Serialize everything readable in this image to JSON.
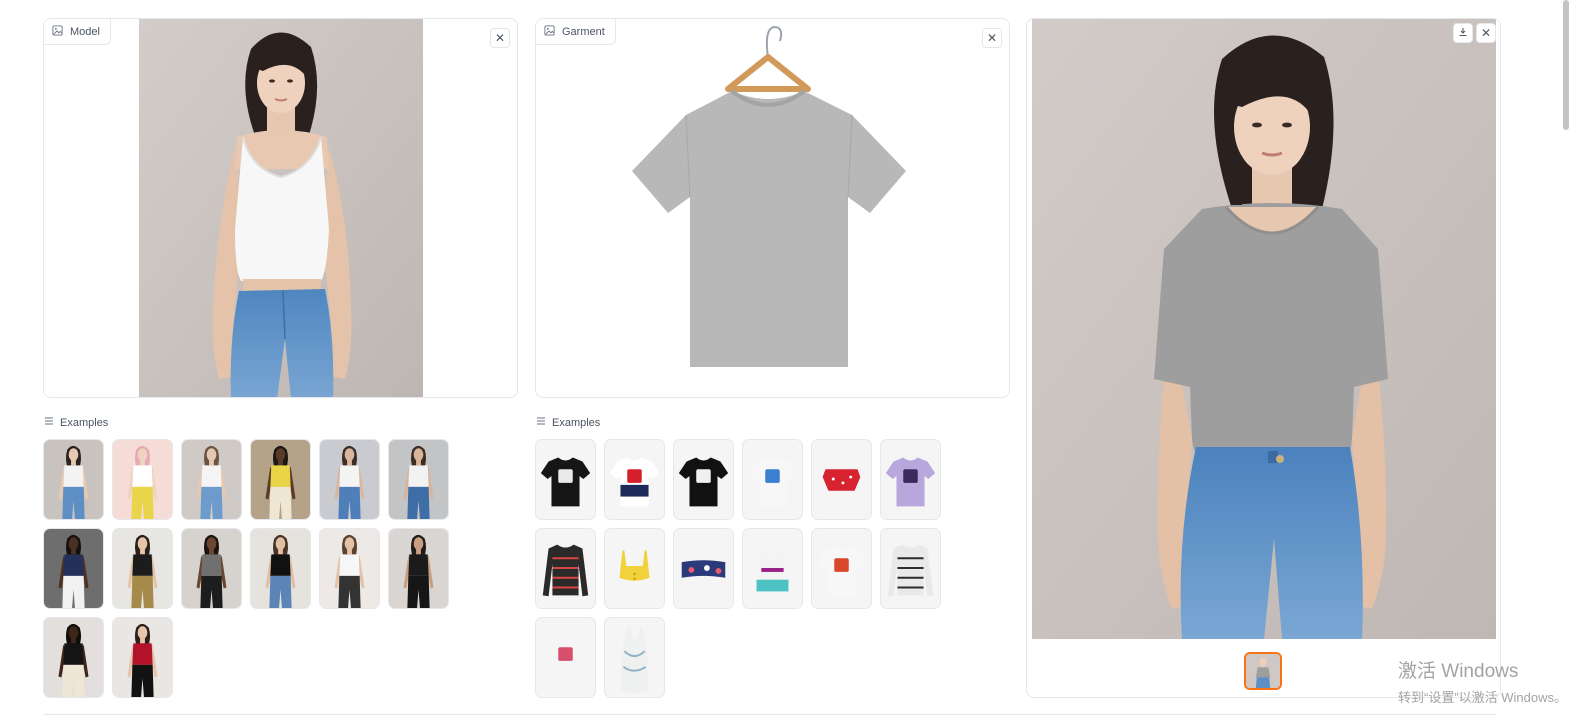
{
  "model_panel": {
    "label": "Model",
    "image_icon": "image-icon",
    "clear_icon": "close-icon"
  },
  "garment_panel": {
    "label": "Garment",
    "image_icon": "image-icon",
    "clear_icon": "close-icon"
  },
  "result_panel": {
    "download_icon": "download-icon",
    "clear_icon": "close-icon",
    "gallery_count": 1
  },
  "model_examples": {
    "label": "Examples",
    "icon": "list-icon",
    "items": [
      {
        "bg": "#c9c3bf",
        "skin": "#e7c8b0",
        "hair": "#2b2220",
        "top": "#f3f3f3",
        "bottom": "#5d8fc4"
      },
      {
        "bg": "#f6dcd6",
        "skin": "#f0d3bf",
        "hair": "#e6a9b6",
        "top": "#ffffff",
        "bottom": "#e9d54a"
      },
      {
        "bg": "#cfcac6",
        "skin": "#e6c7b0",
        "hair": "#6a5545",
        "top": "#f5f5f5",
        "bottom": "#6d9ccc"
      },
      {
        "bg": "#b5a389",
        "skin": "#5a3b27",
        "hair": "#1d1713",
        "top": "#e8d445",
        "bottom": "#efe6d3"
      },
      {
        "bg": "#c9cbd0",
        "skin": "#d9b79c",
        "hair": "#3a2e28",
        "top": "#f4f4f4",
        "bottom": "#4f7fb8"
      },
      {
        "bg": "#c3c4c6",
        "skin": "#d8b49a",
        "hair": "#3b2d23",
        "top": "#f2f2f2",
        "bottom": "#3f6ea6"
      },
      {
        "bg": "#6e6e6e",
        "skin": "#4a3122",
        "hair": "#16110e",
        "top": "#25305a",
        "bottom": "#f1f1f1"
      },
      {
        "bg": "#e8e6e3",
        "skin": "#e6c4a8",
        "hair": "#2a201b",
        "top": "#1c1c1c",
        "bottom": "#a68a4b"
      },
      {
        "bg": "#d6d3cf",
        "skin": "#6b4630",
        "hair": "#1a1411",
        "top": "#707070",
        "bottom": "#1d1d1d"
      },
      {
        "bg": "#e6e2de",
        "skin": "#e1bfa3",
        "hair": "#4a3427",
        "top": "#111111",
        "bottom": "#5b85b6"
      },
      {
        "bg": "#ece9e6",
        "skin": "#e3c2a8",
        "hair": "#5b4130",
        "top": "#f6f6f6",
        "bottom": "#333333"
      },
      {
        "bg": "#d9d5d2",
        "skin": "#c99f84",
        "hair": "#231b17",
        "top": "#1b1b1b",
        "bottom": "#161616"
      },
      {
        "bg": "#e3dfdc",
        "skin": "#3e2718",
        "hair": "#0f0c0a",
        "top": "#141414",
        "bottom": "#efe7d6"
      },
      {
        "bg": "#e9e6e3",
        "skin": "#e5c5ab",
        "hair": "#2b201b",
        "top": "#b3122b",
        "bottom": "#121212"
      }
    ]
  },
  "garment_examples": {
    "label": "Examples",
    "icon": "list-icon",
    "items": [
      {
        "shape": "tee",
        "color": "#161616",
        "accent": "#e9e9e9"
      },
      {
        "shape": "tee",
        "color": "#ffffff",
        "accent": "#d3202a",
        "band": "#1c2a5a"
      },
      {
        "shape": "tee",
        "color": "#111111",
        "accent": "#f0f0f0"
      },
      {
        "shape": "tee",
        "color": "#f7f7f7",
        "accent": "#3b7fd1"
      },
      {
        "shape": "crop",
        "color": "#d7232f",
        "accent": "#ffffff"
      },
      {
        "shape": "tee",
        "color": "#b8a7dc",
        "accent": "#3b2a5a"
      },
      {
        "shape": "long",
        "color": "#2a2a2a",
        "accent": "#d94545"
      },
      {
        "shape": "bra",
        "color": "#f1d23a",
        "accent": "#c9a21a"
      },
      {
        "shape": "bandeau",
        "color": "#2b3a7a",
        "accent": "#e85b6d"
      },
      {
        "shape": "sports",
        "color": "#f4f4f4",
        "accent": "#9a1f86",
        "band": "#4cc3c2"
      },
      {
        "shape": "tee",
        "color": "#f7f7f7",
        "accent": "#d9472a"
      },
      {
        "shape": "long",
        "color": "#e9e9e9",
        "accent": "#2c2c2c"
      },
      {
        "shape": "tee",
        "color": "#f5f5f5",
        "accent": "#d6506c"
      },
      {
        "shape": "cami",
        "color": "#eef1f0",
        "accent": "#8fb3c7"
      }
    ]
  },
  "watermark": {
    "title": "激活 Windows",
    "subtitle": "转到“设置”以激活 Windows。"
  }
}
